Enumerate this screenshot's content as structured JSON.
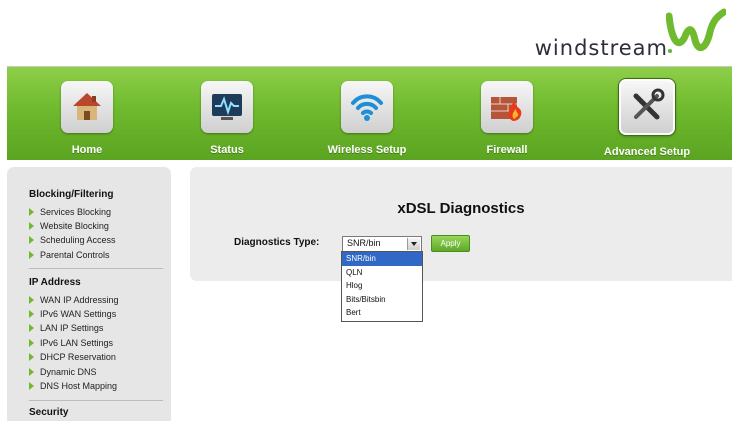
{
  "brand": {
    "name": "windstream",
    "accent": "#6fba2e"
  },
  "nav": {
    "items": [
      {
        "label": "Home",
        "icon": "house-icon"
      },
      {
        "label": "Status",
        "icon": "monitor-pulse-icon"
      },
      {
        "label": "Wireless Setup",
        "icon": "wifi-icon"
      },
      {
        "label": "Firewall",
        "icon": "firewall-icon"
      },
      {
        "label": "Advanced Setup",
        "icon": "tools-icon",
        "active": true
      }
    ]
  },
  "sidebar": {
    "sections": [
      {
        "title": "Blocking/Filtering",
        "items": [
          "Services Blocking",
          "Website Blocking",
          "Scheduling Access",
          "Parental Controls"
        ]
      },
      {
        "title": "IP Address",
        "items": [
          "WAN IP Addressing",
          "IPv6 WAN Settings",
          "LAN IP Settings",
          "IPv6 LAN Settings",
          "DHCP Reservation",
          "Dynamic DNS",
          "DNS Host Mapping"
        ]
      },
      {
        "title": "Security",
        "items": []
      }
    ]
  },
  "main": {
    "title": "xDSL Diagnostics",
    "diagnostics_type_label": "Diagnostics Type:",
    "selected_value": "SNR/bin",
    "apply_label": "Apply",
    "options": [
      "SNR/bin",
      "QLN",
      "Hlog",
      "Bits/Bitsbin",
      "Bert"
    ]
  }
}
